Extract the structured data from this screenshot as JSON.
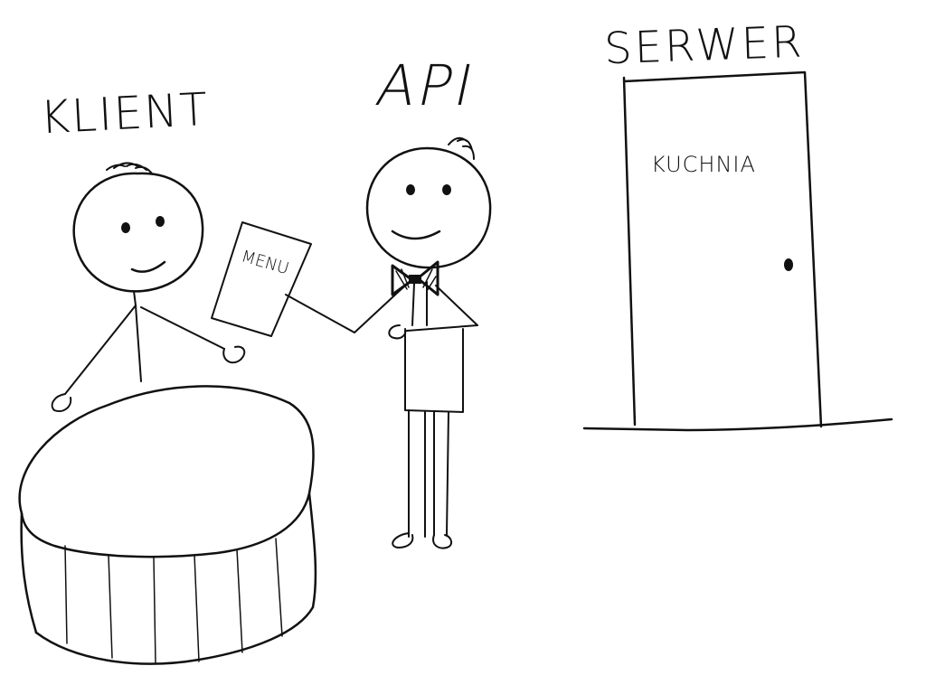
{
  "labels": {
    "client": "KLIENT",
    "api": "API",
    "server": "SERWER",
    "kitchen": "KUCHNIA",
    "menu": "MENU"
  },
  "colors": {
    "ink": "#111111",
    "paper": "#ffffff"
  }
}
